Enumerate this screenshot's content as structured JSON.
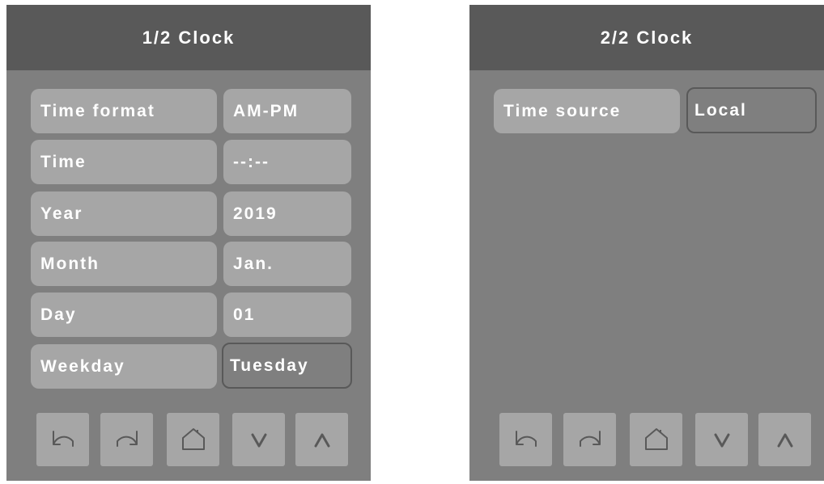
{
  "screens": [
    {
      "title": "1/2 Clock",
      "rows": [
        {
          "label": "Time format",
          "value": "AM-PM"
        },
        {
          "label": "Time",
          "value": "--:--"
        },
        {
          "label": "Year",
          "value": "2019"
        },
        {
          "label": "Month",
          "value": "Jan."
        },
        {
          "label": "Day",
          "value": "01"
        },
        {
          "label": "Weekday",
          "value": "Tuesday",
          "selected": true
        }
      ],
      "nav": [
        "back-icon",
        "forward-icon",
        "home-icon",
        "chevron-down-icon",
        "chevron-up-icon"
      ]
    },
    {
      "title": "2/2 Clock",
      "rows": [
        {
          "label": "Time source",
          "value": "Local",
          "selected": true
        }
      ],
      "nav": [
        "back-icon",
        "forward-icon",
        "home-icon",
        "chevron-down-icon",
        "chevron-up-icon"
      ]
    }
  ],
  "colors": {
    "screen_background": "#7f7f7f",
    "header_background": "#595959",
    "button_background": "#a6a6a6",
    "text": "#ffffff",
    "icon_stroke": "#595959"
  }
}
